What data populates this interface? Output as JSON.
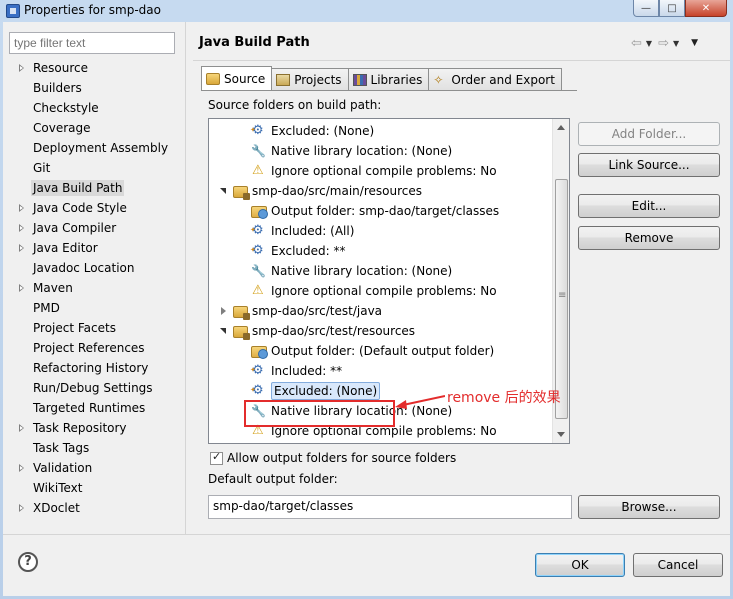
{
  "window": {
    "title": "Properties for smp-dao",
    "controls": {
      "minimize": "—",
      "maximize": "□",
      "close": "✕"
    }
  },
  "sidebar": {
    "filter_placeholder": "type filter text",
    "items": [
      {
        "label": "Resource",
        "expandable": true
      },
      {
        "label": "Builders",
        "expandable": false
      },
      {
        "label": "Checkstyle",
        "expandable": false
      },
      {
        "label": "Coverage",
        "expandable": false
      },
      {
        "label": "Deployment Assembly",
        "expandable": false
      },
      {
        "label": "Git",
        "expandable": false
      },
      {
        "label": "Java Build Path",
        "expandable": false,
        "selected": true
      },
      {
        "label": "Java Code Style",
        "expandable": true
      },
      {
        "label": "Java Compiler",
        "expandable": true
      },
      {
        "label": "Java Editor",
        "expandable": true
      },
      {
        "label": "Javadoc Location",
        "expandable": false
      },
      {
        "label": "Maven",
        "expandable": true
      },
      {
        "label": "PMD",
        "expandable": false
      },
      {
        "label": "Project Facets",
        "expandable": false
      },
      {
        "label": "Project References",
        "expandable": false
      },
      {
        "label": "Refactoring History",
        "expandable": false
      },
      {
        "label": "Run/Debug Settings",
        "expandable": false
      },
      {
        "label": "Targeted Runtimes",
        "expandable": false
      },
      {
        "label": "Task Repository",
        "expandable": true
      },
      {
        "label": "Task Tags",
        "expandable": false
      },
      {
        "label": "Validation",
        "expandable": true
      },
      {
        "label": "WikiText",
        "expandable": false
      },
      {
        "label": "XDoclet",
        "expandable": true
      }
    ]
  },
  "page": {
    "title": "Java Build Path",
    "tabs": [
      "Source",
      "Projects",
      "Libraries",
      "Order and Export"
    ],
    "source_label": "Source folders on build path:",
    "tree": [
      {
        "level": 1,
        "icon": "filter-icon",
        "text": "Excluded: (None)"
      },
      {
        "level": 1,
        "icon": "native-library-icon",
        "text": "Native library location: (None)"
      },
      {
        "level": 1,
        "icon": "warning-icon",
        "text": "Ignore optional compile problems: No"
      },
      {
        "level": 0,
        "icon": "package-folder-icon",
        "twisty": "open",
        "text": "smp-dao/src/main/resources"
      },
      {
        "level": 1,
        "icon": "output-folder-icon",
        "text": "Output folder: smp-dao/target/classes"
      },
      {
        "level": 1,
        "icon": "filter-icon",
        "text": "Included: (All)"
      },
      {
        "level": 1,
        "icon": "filter-icon",
        "text": "Excluded: **"
      },
      {
        "level": 1,
        "icon": "native-library-icon",
        "text": "Native library location: (None)"
      },
      {
        "level": 1,
        "icon": "warning-icon",
        "text": "Ignore optional compile problems: No"
      },
      {
        "level": 0,
        "icon": "package-folder-icon",
        "twisty": "closed",
        "text": "smp-dao/src/test/java"
      },
      {
        "level": 0,
        "icon": "package-folder-icon",
        "twisty": "open",
        "text": "smp-dao/src/test/resources"
      },
      {
        "level": 1,
        "icon": "output-folder-icon",
        "text": "Output folder: (Default output folder)"
      },
      {
        "level": 1,
        "icon": "filter-icon",
        "text": "Included: **"
      },
      {
        "level": 1,
        "icon": "filter-icon",
        "text": "Excluded: (None)",
        "selected": true
      },
      {
        "level": 1,
        "icon": "native-library-icon",
        "text": "Native library location: (None)"
      },
      {
        "level": 1,
        "icon": "warning-icon",
        "text": "Ignore optional compile problems: No"
      }
    ],
    "buttons": {
      "add_folder": "Add Folder...",
      "link_source": "Link Source...",
      "edit": "Edit...",
      "remove": "Remove",
      "browse": "Browse..."
    },
    "allow_output_label": "Allow output folders for source folders",
    "default_output_label": "Default output folder:",
    "default_output_value": "smp-dao/target/classes",
    "annotation": "remove 后的效果"
  },
  "footer": {
    "ok": "OK",
    "cancel": "Cancel",
    "help": "?"
  },
  "colors": {
    "annotation": "#e32c2c",
    "selection": "#d9e8fb"
  }
}
